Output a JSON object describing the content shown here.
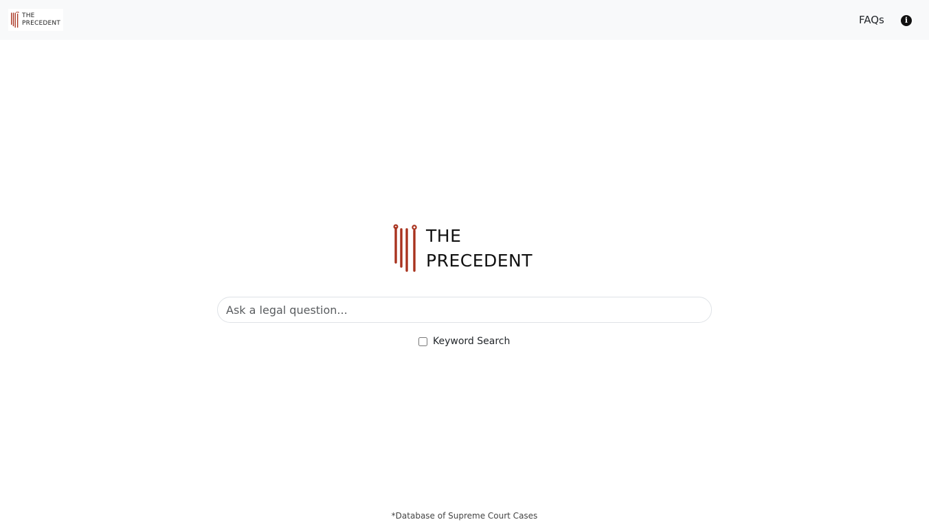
{
  "header": {
    "logo": {
      "line1": "THE",
      "line2": "PRECEDENT",
      "icon": "pillar-logo-icon",
      "brand_color": "#a8321e"
    },
    "faqs_label": "FAQs",
    "info_icon": "info-icon",
    "info_glyph": "i"
  },
  "hero": {
    "logo": {
      "line1": "THE",
      "line2": "PRECEDENT",
      "icon": "pillar-logo-icon",
      "brand_color": "#a8321e"
    }
  },
  "search": {
    "placeholder": "Ask a legal question...",
    "value": ""
  },
  "keyword_search": {
    "label": "Keyword Search",
    "checked": false
  },
  "footer": {
    "note": "*Database of Supreme Court Cases"
  }
}
